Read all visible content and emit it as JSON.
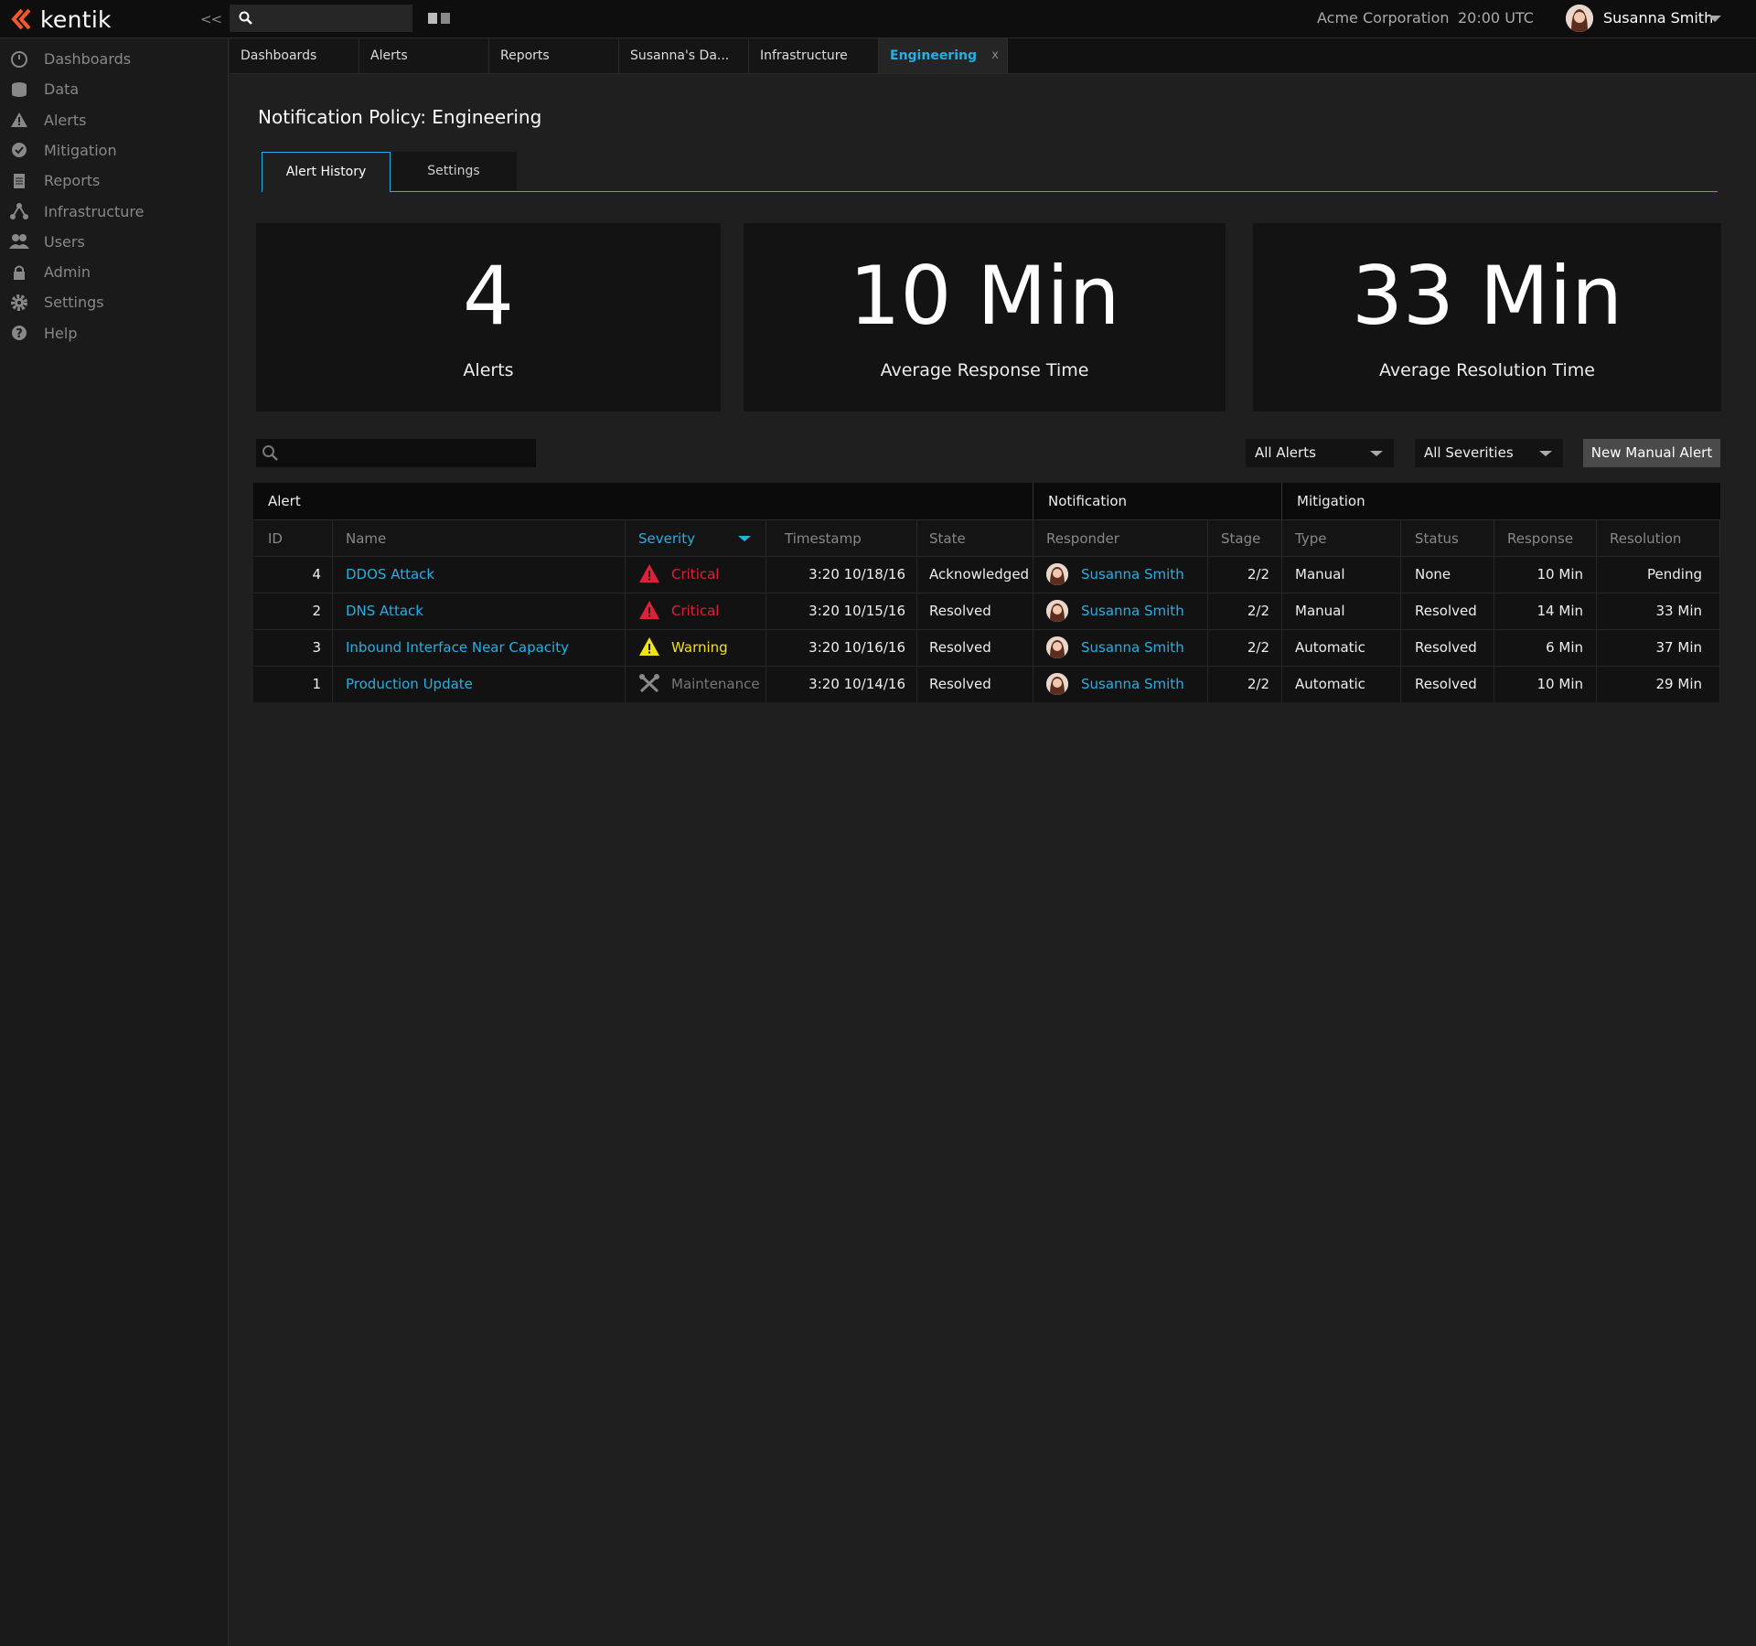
{
  "app": {
    "logo_text": "kentik",
    "collapse_label": "<<",
    "company": "Acme Corporation",
    "clock": "20:00 UTC",
    "user_name": "Susanna Smith",
    "accent_color": "#27aee4"
  },
  "sidebar": {
    "items": [
      {
        "label": "Dashboards",
        "icon": "gauge-icon"
      },
      {
        "label": "Data",
        "icon": "database-icon"
      },
      {
        "label": "Alerts",
        "icon": "warning-icon"
      },
      {
        "label": "Mitigation",
        "icon": "check-circle-icon"
      },
      {
        "label": "Reports",
        "icon": "document-icon"
      },
      {
        "label": "Infrastructure",
        "icon": "network-icon"
      },
      {
        "label": "Users",
        "icon": "users-icon"
      },
      {
        "label": "Admin",
        "icon": "lock-icon"
      },
      {
        "label": "Settings",
        "icon": "gear-icon"
      },
      {
        "label": "Help",
        "icon": "help-icon"
      }
    ]
  },
  "tabs": [
    {
      "label": "Dashboards"
    },
    {
      "label": "Alerts"
    },
    {
      "label": "Reports"
    },
    {
      "label": "Susanna's Da..."
    },
    {
      "label": "Infrastructure"
    },
    {
      "label": "Engineering",
      "active": true,
      "close": "x"
    }
  ],
  "page": {
    "title": "Notification Policy: Engineering",
    "subtabs": [
      "Alert History",
      "Settings"
    ]
  },
  "stats": [
    {
      "value": "4",
      "label": "Alerts"
    },
    {
      "value": "10 Min",
      "label": "Average Response Time"
    },
    {
      "value": "33 Min",
      "label": "Average Resolution Time"
    }
  ],
  "filters": {
    "alerts": "All Alerts",
    "severities": "All Severities",
    "new_button": "New Manual Alert"
  },
  "table": {
    "groups": [
      "Alert",
      "Notification",
      "Mitigation"
    ],
    "columns": [
      "ID",
      "Name",
      "Severity",
      "Timestamp",
      "State",
      "Responder",
      "Stage",
      "Type",
      "Status",
      "Response",
      "Resolution"
    ],
    "rows": [
      {
        "id": "4",
        "name": "DDOS Attack",
        "severity": "Critical",
        "timestamp": "3:20 10/18/16",
        "state": "Acknowledged",
        "responder": "Susanna Smith",
        "stage": "2/2",
        "type": "Manual",
        "status": "None",
        "response": "10 Min",
        "resolution": "Pending"
      },
      {
        "id": "2",
        "name": "DNS Attack",
        "severity": "Critical",
        "timestamp": "3:20 10/15/16",
        "state": "Resolved",
        "responder": "Susanna Smith",
        "stage": "2/2",
        "type": "Manual",
        "status": "Resolved",
        "response": "14 Min",
        "resolution": "33 Min"
      },
      {
        "id": "3",
        "name": "Inbound Interface Near Capacity",
        "severity": "Warning",
        "timestamp": "3:20 10/16/16",
        "state": "Resolved",
        "responder": "Susanna Smith",
        "stage": "2/2",
        "type": "Automatic",
        "status": "Resolved",
        "response": "6 Min",
        "resolution": "37 Min"
      },
      {
        "id": "1",
        "name": "Production Update",
        "severity": "Maintenance",
        "timestamp": "3:20 10/14/16",
        "state": "Resolved",
        "responder": "Susanna Smith",
        "stage": "2/2",
        "type": "Automatic",
        "status": "Resolved",
        "response": "10 Min",
        "resolution": "29 Min"
      }
    ]
  }
}
